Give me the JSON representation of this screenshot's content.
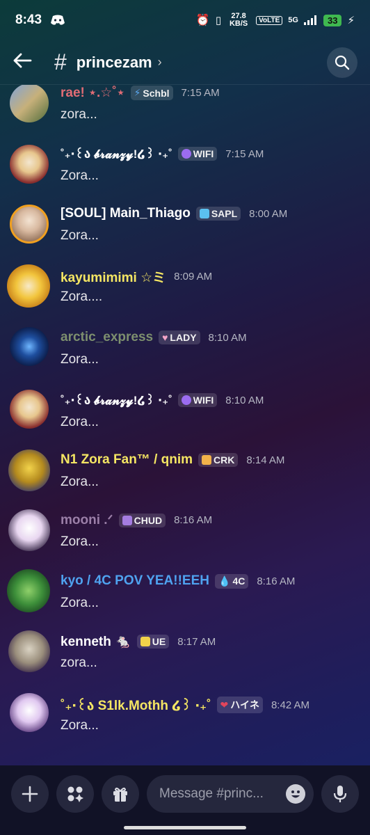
{
  "status_bar": {
    "time": "8:43",
    "net_speed": "27.8 KB/S",
    "volte": "VoLTE",
    "network": "5G",
    "battery": "33"
  },
  "header": {
    "channel": "princezam"
  },
  "messages": [
    {
      "user": "rae! ⋆.☆˚⋆",
      "tag": "Schbl",
      "time": "7:15 AM",
      "text": "zora...",
      "color": "#e06c75"
    },
    {
      "user": "˚₊‧꒰ა 𝓫𝓻𝓪𝓷𝔃𝔂!໒꒱ ‧₊˚",
      "tag": "WIFI",
      "time": "7:15 AM",
      "text": "Zora...",
      "color": "#ffffff"
    },
    {
      "user": "[SOUL] Main_Thiago",
      "tag": "SAPL",
      "time": "8:00 AM",
      "text": "Zora...",
      "color": "#ffffff"
    },
    {
      "user": "kayumimimi ☆ミ",
      "tag": "",
      "time": "8:09 AM",
      "text": "Zora....",
      "color": "#f5e663"
    },
    {
      "user": "arctic_express",
      "tag": "LADY",
      "time": "8:10 AM",
      "text": "Zora...",
      "color": "#7d8f6e"
    },
    {
      "user": "˚₊‧꒰ა 𝓫𝓻𝓪𝓷𝔃𝔂!໒꒱ ‧₊˚",
      "tag": "WIFI",
      "time": "8:10 AM",
      "text": "Zora...",
      "color": "#ffffff"
    },
    {
      "user": "N1 Zora Fan™ / qnim",
      "tag": "CRK",
      "time": "8:14 AM",
      "text": "Zora...",
      "color": "#f5e663"
    },
    {
      "user": "mooni .ᐟ",
      "tag": "CHUD",
      "time": "8:16 AM",
      "text": "Zora...",
      "color": "#9b7fa8"
    },
    {
      "user": "kyo / 4C POV YEA!!EEH",
      "tag": "4C",
      "time": "8:16 AM",
      "text": "Zora...",
      "color": "#4fa3f0"
    },
    {
      "user": "kenneth 🐁",
      "tag": "UE",
      "time": "8:17 AM",
      "text": "zora...",
      "color": "#ffffff"
    },
    {
      "user": "˚₊‧꒰ა S1lk.Mothh ໒꒱ ‧₊˚",
      "tag": "ハイネ",
      "time": "8:42 AM",
      "text": "Zora...",
      "color": "#f5e663"
    }
  ],
  "composer": {
    "placeholder": "Message #princ..."
  },
  "colors": {
    "tag_wifi": "#9b6cf0",
    "tag_sapl": "#5bc0f0",
    "tag_lady": "#f4a5c8",
    "tag_crk": "#f2b24a",
    "tag_chud": "#a57ce0",
    "tag_4c": "#5aa8f0",
    "tag_ue": "#f2d24a",
    "tag_heart": "#e2455b"
  }
}
